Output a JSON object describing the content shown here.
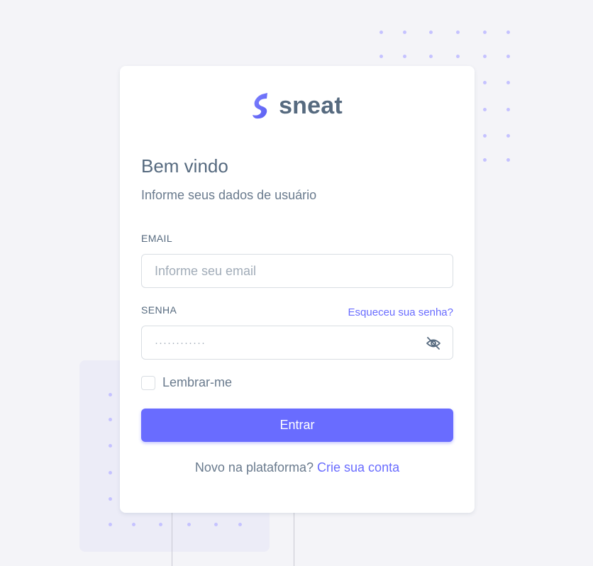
{
  "brand": {
    "name": "sneat",
    "logo_icon": "sneat-logo-icon",
    "accent_color": "#696cff"
  },
  "heading": {
    "title": "Bem vindo",
    "subtitle": "Informe seus dados de usuário"
  },
  "form": {
    "email": {
      "label": "EMAIL",
      "placeholder": "Informe seu email",
      "value": ""
    },
    "password": {
      "label": "SENHA",
      "placeholder": "············",
      "value": "",
      "forgot_link": "Esqueceu sua senha?",
      "toggle_icon": "eye-off-icon"
    },
    "remember": {
      "label": "Lembrar-me",
      "checked": false
    },
    "submit_label": "Entrar"
  },
  "footer": {
    "text": "Novo na plataforma?",
    "link": "Crie sua conta"
  }
}
